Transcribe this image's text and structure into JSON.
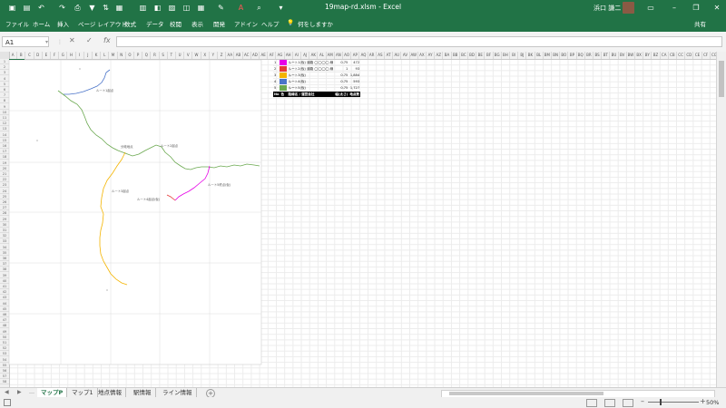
{
  "window": {
    "title": "19map-rd.xlsm  -  Excel",
    "user_name": "浜口 謙二"
  },
  "ribbon": {
    "tabs": [
      "ファイル",
      "ホーム",
      "挿入",
      "ページ レイアウト",
      "数式",
      "データ",
      "校閲",
      "表示",
      "開発",
      "アドイン",
      "ヘルプ"
    ],
    "tell_me": "何をしますか",
    "share": "共有"
  },
  "formula_bar": {
    "name_box": "A1",
    "fx": "fx",
    "value": ""
  },
  "grid": {
    "columns": [
      "A",
      "B",
      "C",
      "D",
      "E",
      "F",
      "G",
      "H",
      "I",
      "J",
      "K",
      "L",
      "M",
      "N",
      "O",
      "P",
      "Q",
      "R",
      "S",
      "T",
      "U",
      "V",
      "W",
      "X",
      "Y",
      "Z",
      "AA",
      "AB",
      "AC",
      "AD",
      "AE",
      "AF",
      "AG",
      "AH",
      "AI",
      "AJ",
      "AK",
      "AL",
      "AM",
      "AN",
      "AO",
      "AP",
      "AQ",
      "AR",
      "AS",
      "AT",
      "AU",
      "AV",
      "AW",
      "AX",
      "AY",
      "AZ",
      "BA",
      "BB",
      "BC",
      "BD",
      "BE",
      "BF",
      "BG",
      "BH",
      "BI",
      "BJ",
      "BK",
      "BL",
      "BM",
      "BN",
      "BO",
      "BP",
      "BQ",
      "BR",
      "BS",
      "BT",
      "BU",
      "BV",
      "BW",
      "BX",
      "BY",
      "BZ",
      "CA",
      "CB",
      "CC",
      "CD",
      "CE",
      "CF",
      "CG",
      "CH"
    ],
    "row_count": 58
  },
  "map": {
    "labels": [
      {
        "text": "ルート1起点",
        "color": "#555"
      },
      {
        "text": "分岐地点",
        "color": "#555"
      },
      {
        "text": "ルート2起点",
        "color": "#555"
      },
      {
        "text": "ルート3起点",
        "color": "#555"
      },
      {
        "text": "ルート4起点(仮)",
        "color": "#555"
      },
      {
        "text": "ルート5終点(仮)",
        "color": "#555"
      }
    ],
    "routes": [
      {
        "name": "blue",
        "color": "#4a74c9"
      },
      {
        "name": "green",
        "color": "#6aa84f"
      },
      {
        "name": "orange",
        "color": "#f4b400"
      },
      {
        "name": "magenta",
        "color": "#e600e6"
      },
      {
        "name": "red",
        "color": "#e53935"
      }
    ]
  },
  "legend": {
    "header": [
      "No",
      "色",
      "路線名 / 運営会社",
      "幅(太さ)",
      "地点数"
    ],
    "rows": [
      {
        "no": "1",
        "color": "#e600e6",
        "name": "ルート1(仮) 道路 ◯◯◯◯ 線",
        "width": "0.75",
        "count": "472"
      },
      {
        "no": "2",
        "color": "#e53935",
        "name": "ルート2(仮) 道路 ◯◯◯◯ 線",
        "width": "1",
        "count": "93"
      },
      {
        "no": "3",
        "color": "#f4b400",
        "name": "ルート3(仮)",
        "width": "0.75",
        "count": "1,884"
      },
      {
        "no": "4",
        "color": "#4a74c9",
        "name": "ルート4(仮)",
        "width": "0.75",
        "count": "593"
      },
      {
        "no": "5",
        "color": "#6aa84f",
        "name": "ルート5(仮)",
        "width": "0.75",
        "count": "1,727"
      }
    ]
  },
  "sheets": {
    "tabs": [
      "マップP",
      "マップ1",
      "地点情報",
      "駅情報",
      "ライン情報"
    ],
    "active": 0
  },
  "status": {
    "zoom": "50%"
  }
}
